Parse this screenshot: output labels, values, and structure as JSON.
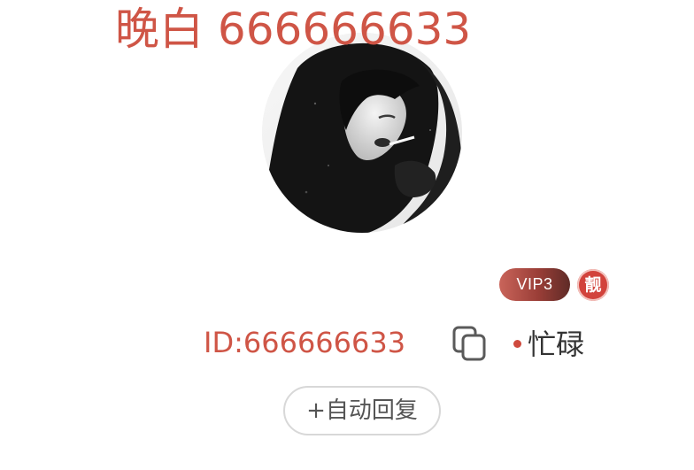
{
  "profile": {
    "username": "晚白 666666633",
    "vip_label": "VIP3",
    "liang_label": "靓",
    "user_id": "ID:666666633",
    "status": "忙碌",
    "auto_reply_label": "+自动回复"
  },
  "icons": {
    "copy": "copy-icon",
    "status_dot": "status-dot-icon",
    "avatar": "avatar-image"
  },
  "colors": {
    "accent": "#cf5546",
    "status_dot": "#cf4a3d",
    "badge_liang": "#d2433c",
    "vip_gradient_start": "#c9645a",
    "vip_gradient_end": "#5f2b27",
    "button_border": "#d8d8d8"
  }
}
